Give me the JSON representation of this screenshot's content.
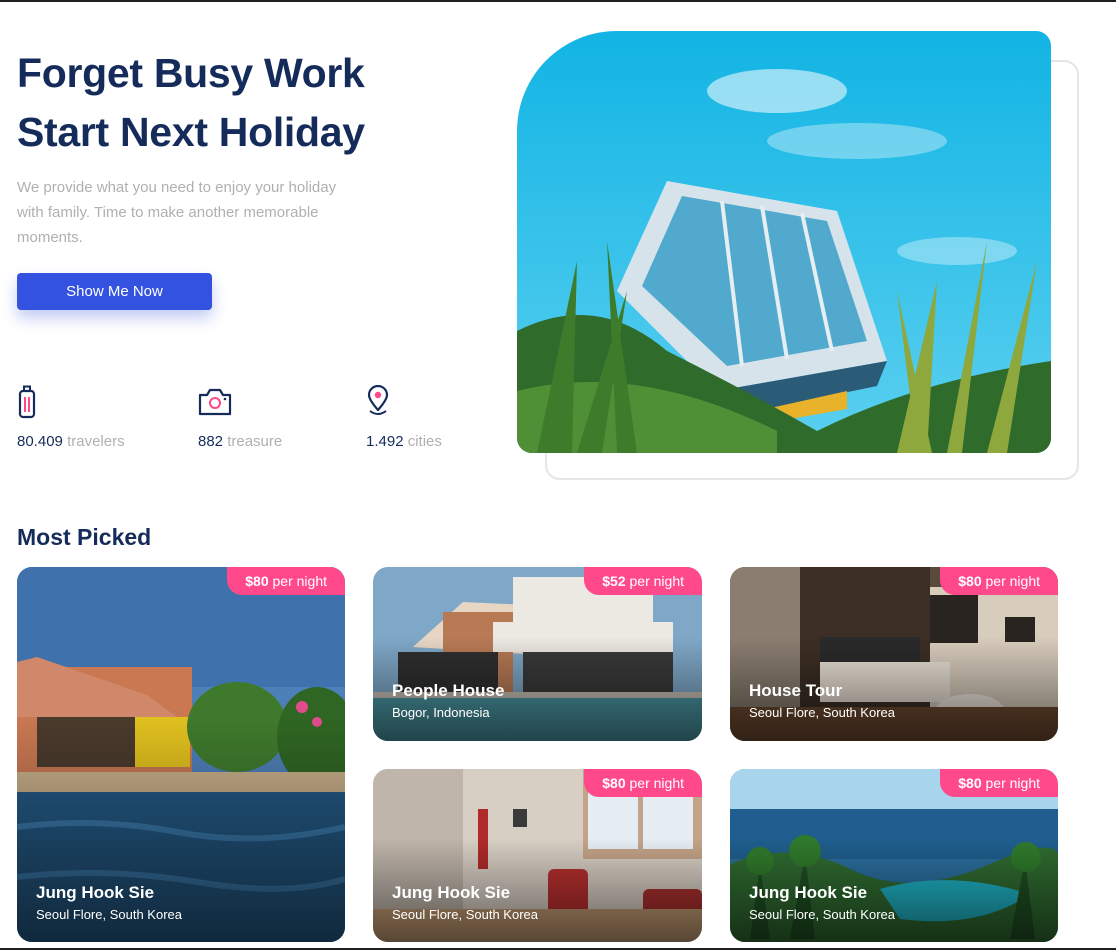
{
  "hero": {
    "title_line1": "Forget Busy Work",
    "title_line2": "Start Next Holiday",
    "description": "We provide what you need to enjoy your holiday with family. Time to make another memorable moments.",
    "cta_label": "Show Me Now"
  },
  "stats": [
    {
      "icon": "luggage-icon",
      "number": "80.409",
      "unit": "travelers"
    },
    {
      "icon": "camera-icon",
      "number": "882",
      "unit": "treasure"
    },
    {
      "icon": "location-pin-icon",
      "number": "1.492",
      "unit": "cities"
    }
  ],
  "most_picked": {
    "title": "Most Picked",
    "cards": [
      {
        "price": "$80",
        "per": "per night",
        "name": "Jung Hook Sie",
        "location": "Seoul Flore, South Korea"
      },
      {
        "price": "$52",
        "per": "per night",
        "name": "People House",
        "location": "Bogor, Indonesia"
      },
      {
        "price": "$80",
        "per": "per night",
        "name": "House Tour",
        "location": "Seoul Flore, South Korea"
      },
      {
        "price": "$80",
        "per": "per night",
        "name": "Jung Hook Sie",
        "location": "Seoul Flore, South Korea"
      },
      {
        "price": "$80",
        "per": "per night",
        "name": "Jung Hook Sie",
        "location": "Seoul Flore, South Korea"
      }
    ]
  },
  "colors": {
    "primary": "#3252DF",
    "heading": "#152C5B",
    "muted": "#B0B0B0",
    "accent": "#FF498B"
  }
}
